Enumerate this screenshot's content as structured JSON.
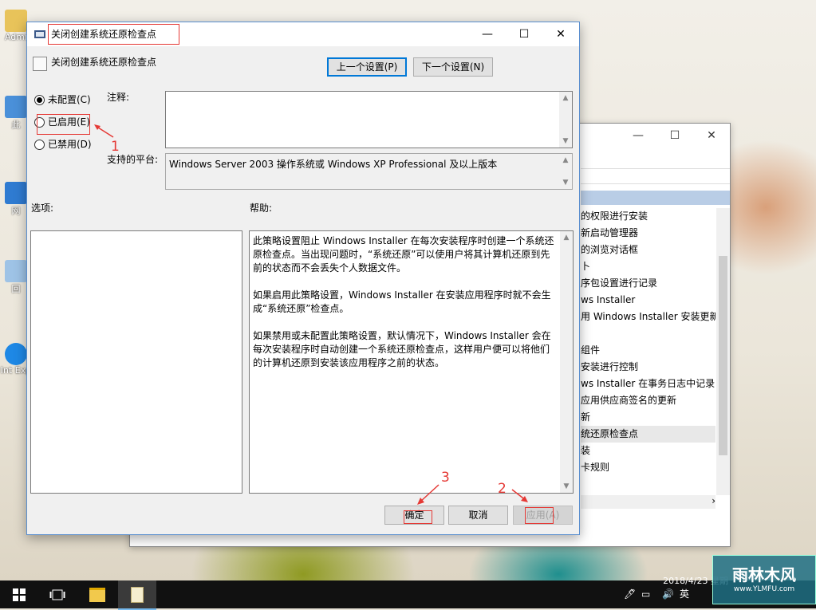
{
  "dialog": {
    "window_title": "关闭创建系统还原检查点",
    "header_title": "关闭创建系统还原检查点",
    "prev_button": "上一个设置(P)",
    "next_button": "下一个设置(N)",
    "radio_not_configured": "未配置(C)",
    "radio_enabled": "已启用(E)",
    "radio_disabled": "已禁用(D)",
    "comment_label": "注释:",
    "platform_label": "支持的平台:",
    "platform_value": "Windows Server 2003 操作系统或 Windows XP Professional 及以上版本",
    "options_label": "选项:",
    "help_label": "帮助:",
    "help_paragraphs": [
      "此策略设置阻止 Windows Installer 在每次安装程序时创建一个系统还原检查点。当出现问题时，“系统还原”可以使用户将其计算机还原到先前的状态而不会丢失个人数据文件。",
      "如果启用此策略设置，Windows Installer 在安装应用程序时就不会生成“系统还原”检查点。",
      "如果禁用或未配置此策略设置，默认情况下，Windows Installer 会在每次安装程序时自动创建一个系统还原检查点，这样用户便可以将他们的计算机还原到安装该应用程序之前的状态。"
    ],
    "ok_button": "确定",
    "cancel_button": "取消",
    "apply_button": "应用(A)",
    "caption_minimize": "—",
    "caption_maximize": "☐",
    "caption_close": "✕"
  },
  "annotations": {
    "one": "1",
    "two": "2",
    "three": "3",
    "color": "#e53935"
  },
  "background_window": {
    "items": [
      "的权限进行安装",
      "新启动管理器",
      "的浏览对话框",
      "卜",
      "序包设置进行记录",
      "ws Installer",
      "用 Windows Installer 安装更新和",
      "",
      "组件",
      "安装进行控制",
      "ws Installer 在事务日志中记录的",
      "应用供应商签名的更新",
      "新",
      "统还原检查点",
      "装",
      "卡规则"
    ]
  },
  "desktop": {
    "icons": [
      "Admi",
      "此",
      "网",
      "回",
      "Int Exp"
    ]
  },
  "taskbar": {
    "clock_date": "2018/4/23 星期",
    "ime": "英"
  },
  "watermark": {
    "title": "雨林木风",
    "url": "www.YLMFU.com"
  }
}
